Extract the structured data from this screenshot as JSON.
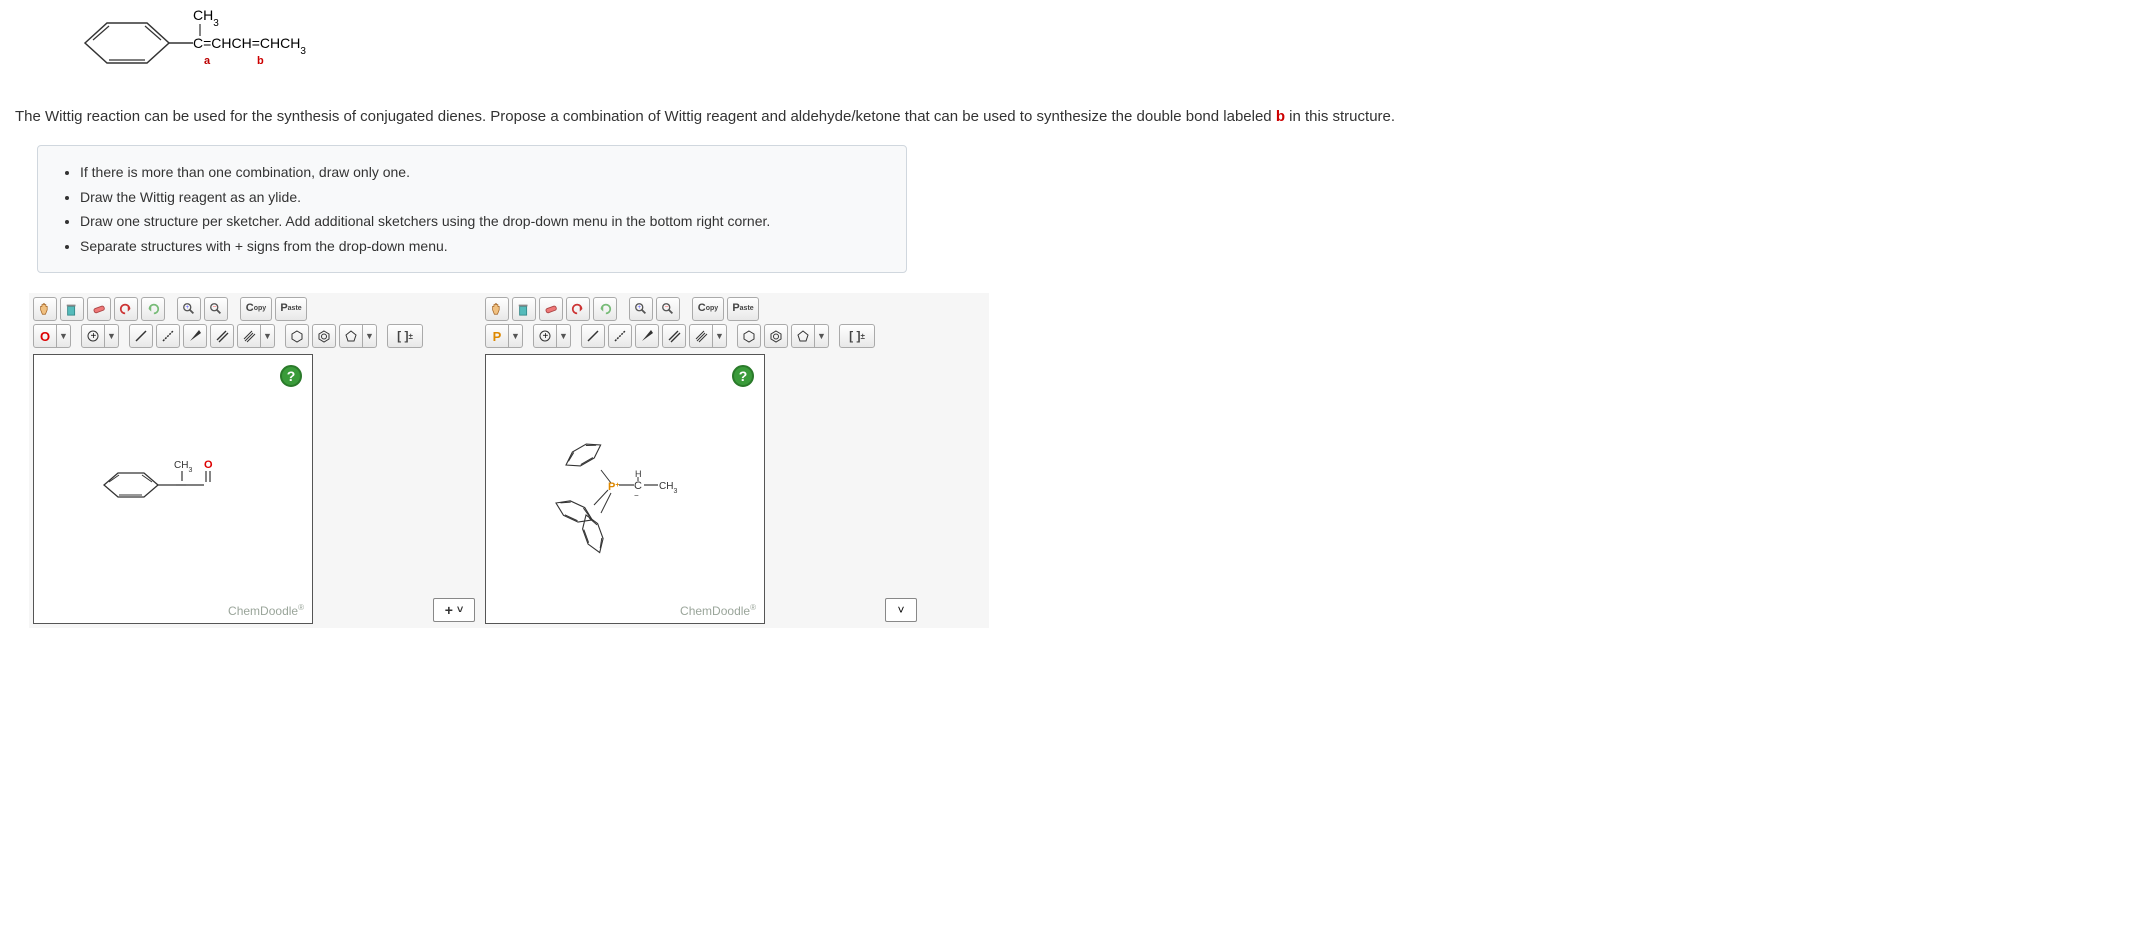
{
  "question": {
    "text_prefix": "The Wittig reaction can be used for the synthesis of conjugated dienes. Propose a combination of Wittig reagent and aldehyde/ketone that can be used to synthesize the double bond labeled ",
    "label_b": "b",
    "text_suffix": " in this structure."
  },
  "top_structure": {
    "ch3_top": "CH",
    "ch3_sub": "3",
    "chain": "C=CHCH=CHCH",
    "chain_sub": "3",
    "label_a": "a",
    "label_b": "b"
  },
  "instructions": [
    "If there is more than one combination, draw only one.",
    "Draw the Wittig reagent as an ylide.",
    "Draw one structure per sketcher. Add additional sketchers using the drop-down menu in the bottom right corner.",
    "Separate structures with + signs from the drop-down menu."
  ],
  "sketcher_common": {
    "copy_label": "C\nopy",
    "paste_label": "P\naste",
    "help": "?",
    "brand": "ChemDoodle",
    "brand_mark": "®",
    "charge_bracket": "[ ]",
    "charge_sign": "±"
  },
  "sketcher1": {
    "element_label": "O",
    "molecule": {
      "ch3": "CH",
      "ch3_sub": "3",
      "oxygen": "O"
    }
  },
  "sketcher2": {
    "element_label": "P",
    "molecule": {
      "p_plus": "P",
      "plus": "+",
      "h_atom": "H",
      "c_atom": "C",
      "ch3": "CH",
      "ch3_sub": "3"
    }
  },
  "controls": {
    "add": "+",
    "add_caret": "˅",
    "dd_caret": "˅"
  }
}
